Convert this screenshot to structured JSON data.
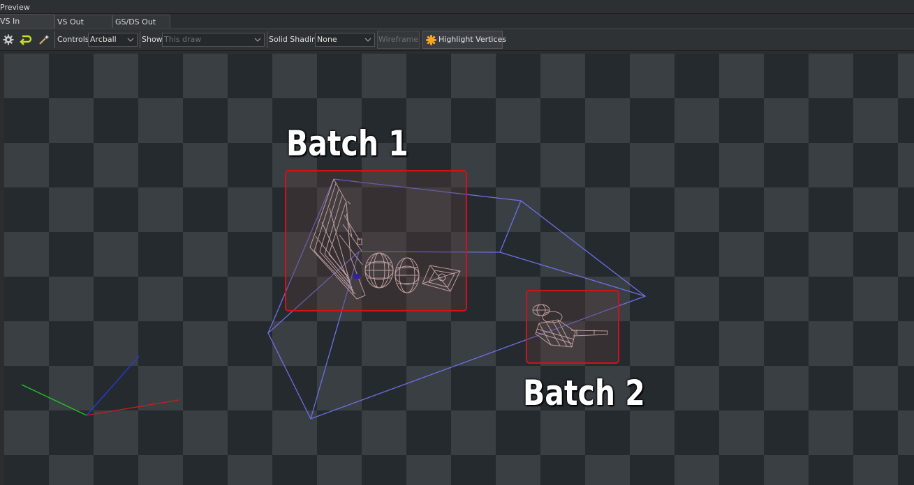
{
  "panel": {
    "title": "Preview"
  },
  "tabs": [
    {
      "label": "VS In",
      "active": true
    },
    {
      "label": "VS Out",
      "active": false
    },
    {
      "label": "GS/DS Out",
      "active": false
    }
  ],
  "toolbar": {
    "controls_label": "Controls",
    "controls_value": "Arcball",
    "show_label": "Show",
    "show_value": "This draw",
    "solid_shading_label": "Solid Shading",
    "solid_shading_value": "None",
    "wireframe_label": "Wireframe",
    "highlight_vertices_label": "Highlight Vertices",
    "icons": [
      "gear-icon",
      "reset-arrow-icon",
      "magic-wand-icon",
      "highlight-asterisk-icon"
    ]
  },
  "viewport": {
    "annotations": [
      {
        "label": "Batch 1",
        "box_color": "#d0121b"
      },
      {
        "label": "Batch 2",
        "box_color": "#d0121b"
      }
    ],
    "frustum_color": "#6f6fe6",
    "mesh_color": "#f4cfcf",
    "axis_colors": {
      "x": "#d01c1c",
      "y": "#22c622",
      "z": "#2a3be0"
    }
  }
}
